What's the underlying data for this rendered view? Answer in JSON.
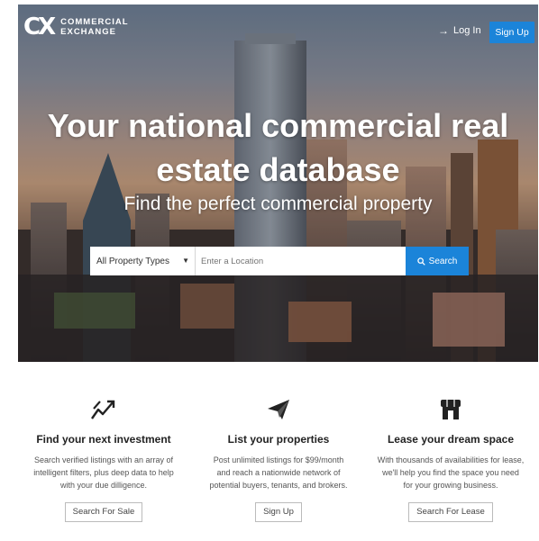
{
  "header": {
    "logo_mark": "CX",
    "logo_line1": "COMMERCIAL",
    "logo_line2": "EXCHANGE",
    "login_label": "Log In",
    "signup_label": "Sign Up"
  },
  "hero": {
    "headline_line1": "Your national commercial real",
    "headline_line2": "estate database",
    "subheadline": "Find the perfect commercial property"
  },
  "search": {
    "property_type_selected": "All Property Types",
    "location_placeholder": "Enter a Location",
    "search_label": "Search"
  },
  "features": [
    {
      "icon": "chart-trend-icon",
      "title": "Find your next investment",
      "desc_lines": [
        "Search verified listings with an array of",
        "intelligent filters, plus deep data to help",
        "with your due dilligence."
      ],
      "button": "Search For Sale"
    },
    {
      "icon": "paper-plane-icon",
      "title": "List your properties",
      "desc_lines": [
        "Post unlimited listings for $99/month",
        "and reach a nationwide network of",
        "potential buyers, tenants, and brokers."
      ],
      "button": "Sign Up"
    },
    {
      "icon": "storefront-icon",
      "title": "Lease your dream space",
      "desc_lines": [
        "With thousands of availabilities for lease,",
        "we'll help you find the space you need",
        "for your growing business."
      ],
      "button": "Search For Lease"
    }
  ]
}
